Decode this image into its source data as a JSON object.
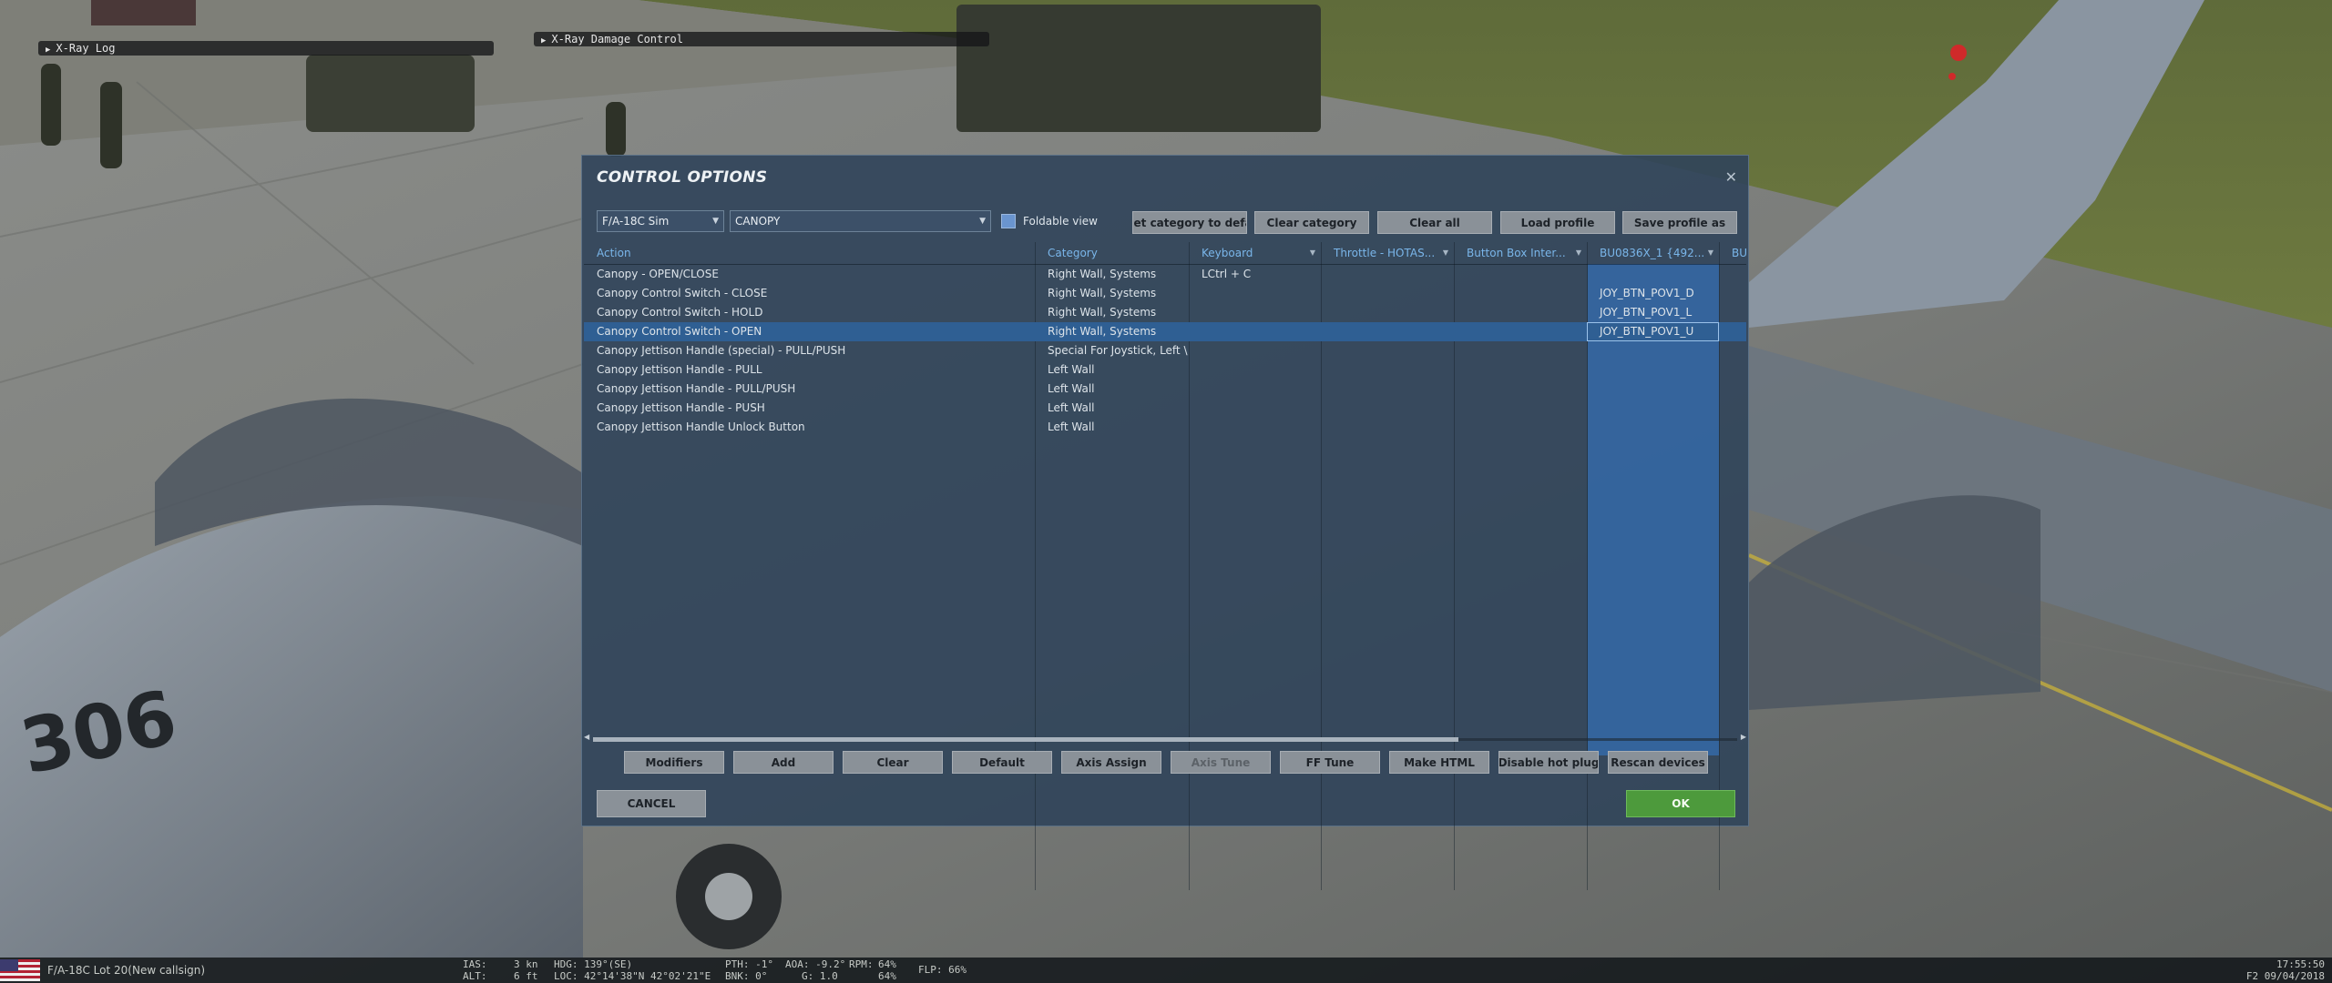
{
  "overlays": {
    "xray_log": "X-Ray Log",
    "xray_damage": "X-Ray Damage Control"
  },
  "dialog": {
    "title": "CONTROL OPTIONS",
    "close_icon": "✕",
    "aircraft_select": "F/A-18C Sim",
    "category_select": "CANOPY",
    "foldable_label": "Foldable view",
    "buttons_top": {
      "reset_category": "set category to defa",
      "clear_category": "Clear category",
      "clear_all": "Clear all",
      "load_profile": "Load profile",
      "save_profile_as": "Save profile as"
    },
    "columns": [
      "Action",
      "Category",
      "Keyboard",
      "Throttle - HOTAS...",
      "Button Box Inter...",
      "BU0836X_1 {492...",
      "BU"
    ],
    "rows": [
      {
        "action": "Canopy - OPEN/CLOSE",
        "category": "Right Wall, Systems",
        "keyboard": "LCtrl + C",
        "bu0836x": ""
      },
      {
        "action": "Canopy Control Switch - CLOSE",
        "category": "Right Wall, Systems",
        "keyboard": "",
        "bu0836x": "JOY_BTN_POV1_D"
      },
      {
        "action": "Canopy Control Switch - HOLD",
        "category": "Right Wall, Systems",
        "keyboard": "",
        "bu0836x": "JOY_BTN_POV1_L"
      },
      {
        "action": "Canopy Control Switch - OPEN",
        "category": "Right Wall, Systems",
        "keyboard": "",
        "bu0836x": "JOY_BTN_POV1_U"
      },
      {
        "action": "Canopy Jettison Handle (special) - PULL/PUSH",
        "category": "Special For Joystick, Left \\",
        "keyboard": "",
        "bu0836x": ""
      },
      {
        "action": "Canopy Jettison Handle - PULL",
        "category": "Left Wall",
        "keyboard": "",
        "bu0836x": ""
      },
      {
        "action": "Canopy Jettison Handle - PULL/PUSH",
        "category": "Left Wall",
        "keyboard": "",
        "bu0836x": ""
      },
      {
        "action": "Canopy Jettison Handle - PUSH",
        "category": "Left Wall",
        "keyboard": "",
        "bu0836x": ""
      },
      {
        "action": "Canopy Jettison Handle Unlock Button",
        "category": "Left Wall",
        "keyboard": "",
        "bu0836x": ""
      }
    ],
    "buttons_bottom": {
      "modifiers": "Modifiers",
      "add": "Add",
      "clear": "Clear",
      "default": "Default",
      "axis_assign": "Axis Assign",
      "axis_tune": "Axis Tune",
      "ff_tune": "FF Tune",
      "make_html": "Make HTML",
      "disable_hot_plug": "Disable hot plug",
      "rescan_devices": "Rescan devices"
    },
    "cancel": "CANCEL",
    "ok": "OK"
  },
  "hud": {
    "unit": "F/A-18C Lot 20(New callsign)",
    "ias_label": "IAS:",
    "ias_value": "3 kn",
    "alt_label": "ALT:",
    "alt_value": "6 ft",
    "hdg": "HDG: 139°(SE)",
    "loc": "LOC: 42°14'38\"N 42°02'21\"E",
    "pth": "PTH: -1°",
    "bnk": "BNK: 0°",
    "aoa": "AOA: -9.2°",
    "g": "G: 1.0",
    "rpm_label": "RPM:",
    "rpm_1": "64%",
    "rpm_2": "64%",
    "flp": "FLP: 66%",
    "time": "17:55:50",
    "date": "F2 09/04/2018"
  },
  "colors": {
    "accent": "#7ab6ea",
    "selected_row": "#2f5f93",
    "ok_button": "#4d9a3c"
  }
}
